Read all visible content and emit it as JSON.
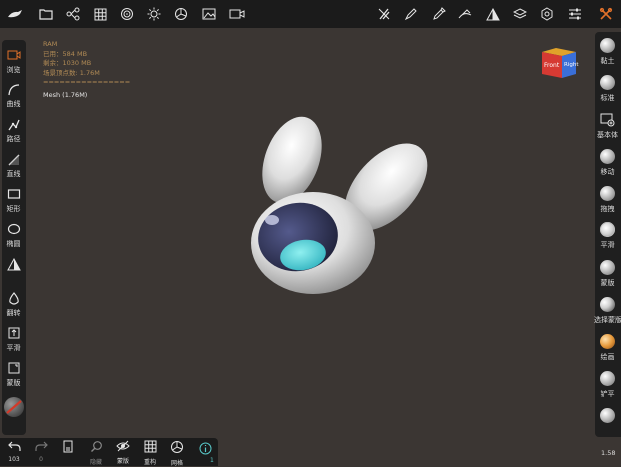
{
  "top_toolbar": {
    "icons": [
      "app-logo-icon",
      "folder-icon",
      "scene-tree-icon",
      "grid-icon",
      "material-icon",
      "light-icon",
      "camera-settings-icon",
      "image-icon",
      "video-icon",
      "symmetry-off-icon",
      "brush-icon",
      "picker-icon",
      "flatten-icon",
      "triangle-icon",
      "layers-icon",
      "settings-icon",
      "sliders-icon",
      "tools-icon"
    ]
  },
  "info": {
    "ram_title": "RAM",
    "used": "已用：584 MB",
    "free": "剩余：1030 MB",
    "scene_vertices": "场景顶点数: 1.76M",
    "separator": "================",
    "mesh": "Mesh (1.76M)"
  },
  "view_cube": {
    "front": "Front",
    "right": "Right"
  },
  "left_tools": [
    {
      "icon": "camera-view-icon",
      "label": "浏览"
    },
    {
      "icon": "curve-icon",
      "label": "曲线"
    },
    {
      "icon": "path-icon",
      "label": "路径"
    },
    {
      "icon": "line-icon",
      "label": "直线"
    },
    {
      "icon": "rectangle-icon",
      "label": "矩形"
    },
    {
      "icon": "ellipse-icon",
      "label": "椭圆"
    },
    {
      "icon": "symmetry-icon",
      "label": ""
    },
    {
      "icon": "invert-icon",
      "label": "翻转"
    },
    {
      "icon": "smooth-icon",
      "label": "平滑"
    },
    {
      "icon": "mask-icon",
      "label": "蒙版"
    }
  ],
  "right_tools": [
    {
      "label": "黏土"
    },
    {
      "label": "标准"
    },
    {
      "label": "基本体"
    },
    {
      "label": "移动"
    },
    {
      "label": "拖拽"
    },
    {
      "label": "平滑"
    },
    {
      "label": "蒙版"
    },
    {
      "label": "选择蒙版"
    },
    {
      "label": "绘画"
    },
    {
      "label": "铲平"
    },
    {
      "label": ""
    }
  ],
  "bottom_toolbar": {
    "undo_count": "103",
    "redo_count": "0",
    "items": [
      {
        "icon": "undo-icon",
        "label": "103"
      },
      {
        "icon": "redo-icon",
        "label": "0"
      },
      {
        "icon": "mesh-panel-icon",
        "label": ""
      },
      {
        "icon": "search-icon",
        "label": "隐藏"
      },
      {
        "icon": "hide-icon",
        "label": "蒙版"
      },
      {
        "icon": "grid-icon",
        "label": "重构"
      },
      {
        "icon": "wireframe-icon",
        "label": "网格"
      },
      {
        "icon": "info-icon",
        "label": "1"
      }
    ]
  },
  "version": "1.58",
  "colors": {
    "background": "#3b3633",
    "panel": "#1f1f1f",
    "accent_orange": "#e0702a",
    "cube_red": "#d63a33",
    "cube_blue": "#3a6fd8"
  }
}
